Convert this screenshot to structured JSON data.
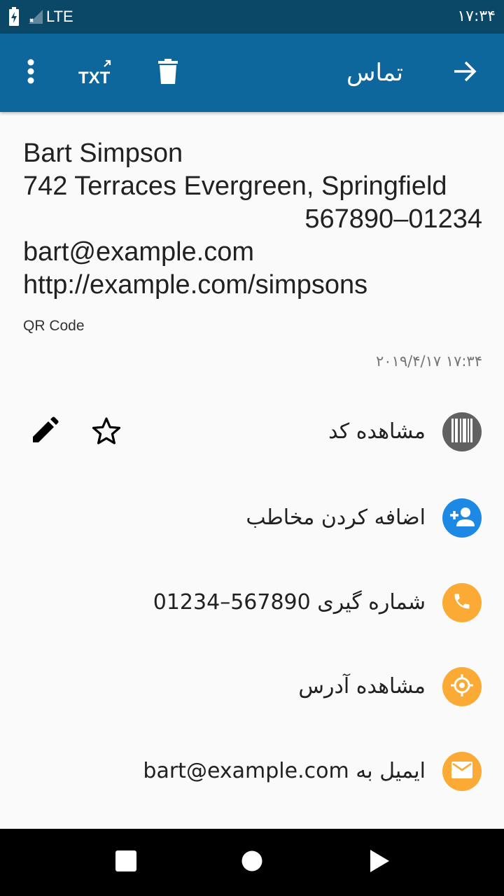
{
  "status_bar": {
    "network": "LTE",
    "time": "۱۷:۳۴",
    "icons": [
      "battery-charging-icon",
      "signal-icon"
    ]
  },
  "app_bar": {
    "title": "تماس",
    "icons": [
      "more-vert-icon",
      "txt-export-icon",
      "delete-icon",
      "arrow-forward-icon"
    ],
    "txt_label": "TXT"
  },
  "content": {
    "name": "Bart Simpson",
    "address": "742 Terraces Evergreen, Springfield",
    "phone": "567890–01234",
    "email": "bart@example.com",
    "url": "http://example.com/simpsons",
    "format": "QR Code",
    "timestamp": "۱۷:۳۴ ۲۰۱۹/۴/۱۷"
  },
  "actions": [
    {
      "label": "مشاهده کد",
      "icon": "barcode-icon",
      "color": "#616161"
    },
    {
      "label": "اضافه کردن مخاطب",
      "icon": "person-add-icon",
      "color": "#1e88e5"
    },
    {
      "label": "شماره گیری 567890–01234",
      "icon": "phone-icon",
      "color": "#fbab35"
    },
    {
      "label": "مشاهده آدرس",
      "icon": "location-icon",
      "color": "#fbab35"
    },
    {
      "label": "ایمیل به bart@example.com",
      "icon": "email-icon",
      "color": "#fbab35"
    }
  ],
  "row_tools": [
    "edit-icon",
    "star-outline-icon"
  ],
  "nav_bar": [
    "recent-apps-icon",
    "home-icon",
    "back-icon"
  ],
  "colors": {
    "status_bar": "#0b4868",
    "app_bar": "#0d679c",
    "background": "#fafafa"
  }
}
